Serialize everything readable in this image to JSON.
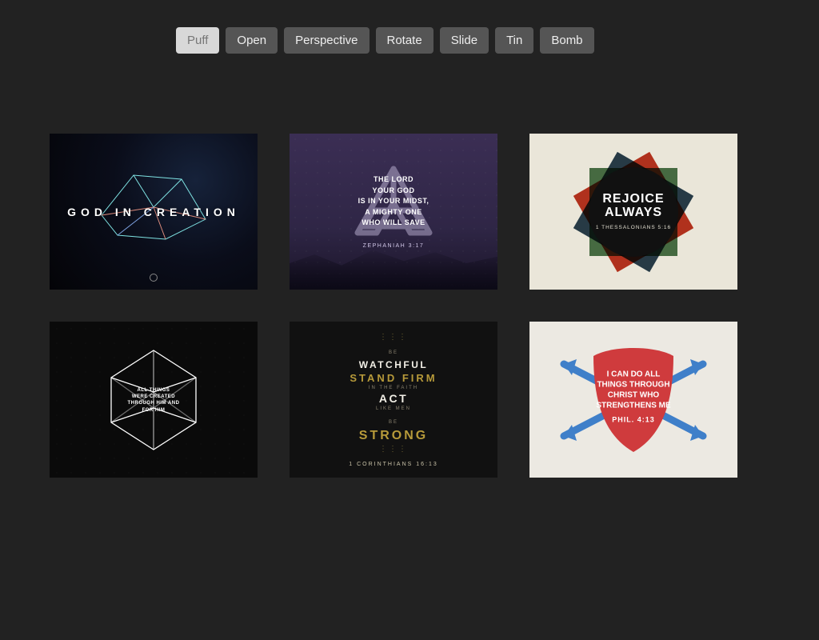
{
  "tabs": [
    {
      "label": "Puff",
      "active": true
    },
    {
      "label": "Open",
      "active": false
    },
    {
      "label": "Perspective",
      "active": false
    },
    {
      "label": "Rotate",
      "active": false
    },
    {
      "label": "Slide",
      "active": false
    },
    {
      "label": "Tin",
      "active": false
    },
    {
      "label": "Bomb",
      "active": false
    }
  ],
  "cards": {
    "c1": {
      "title": "GOD IN CREATION"
    },
    "c2": {
      "line1": "THE LORD",
      "line2": "YOUR GOD",
      "line3": "IS IN YOUR MIDST,",
      "line4": "A MIGHTY ONE",
      "line5": "WHO WILL SAVE",
      "ref": "ZEPHANIAH 3:17"
    },
    "c3": {
      "line1": "REJOICE",
      "line2": "ALWAYS",
      "ref": "1 THESSALONIANS 5:16"
    },
    "c4": {
      "line1": "ALL THINGS",
      "line2": "WERE CREATED",
      "line3": "THROUGH HIM AND",
      "line4": "FOR HIM"
    },
    "c5": {
      "be1": "BE",
      "watchful": "WATCHFUL",
      "stand": "STAND FIRM",
      "faith": "IN THE FAITH",
      "act": "ACT",
      "men": "LIKE MEN",
      "be2": "BE",
      "strong": "STRONG",
      "ref": "1 CORINTHIANS 16:13"
    },
    "c6": {
      "line1": "I CAN DO ALL",
      "line2": "THINGS THROUGH",
      "line3": "CHRIST WHO",
      "line4": "STRENGTHENS ME",
      "ref": "PHIL. 4:13"
    }
  },
  "colors": {
    "burst": [
      "#e8c23c",
      "#2e8f55",
      "#c94040",
      "#2b6fae",
      "#6a3e8f",
      "#d07030"
    ]
  }
}
